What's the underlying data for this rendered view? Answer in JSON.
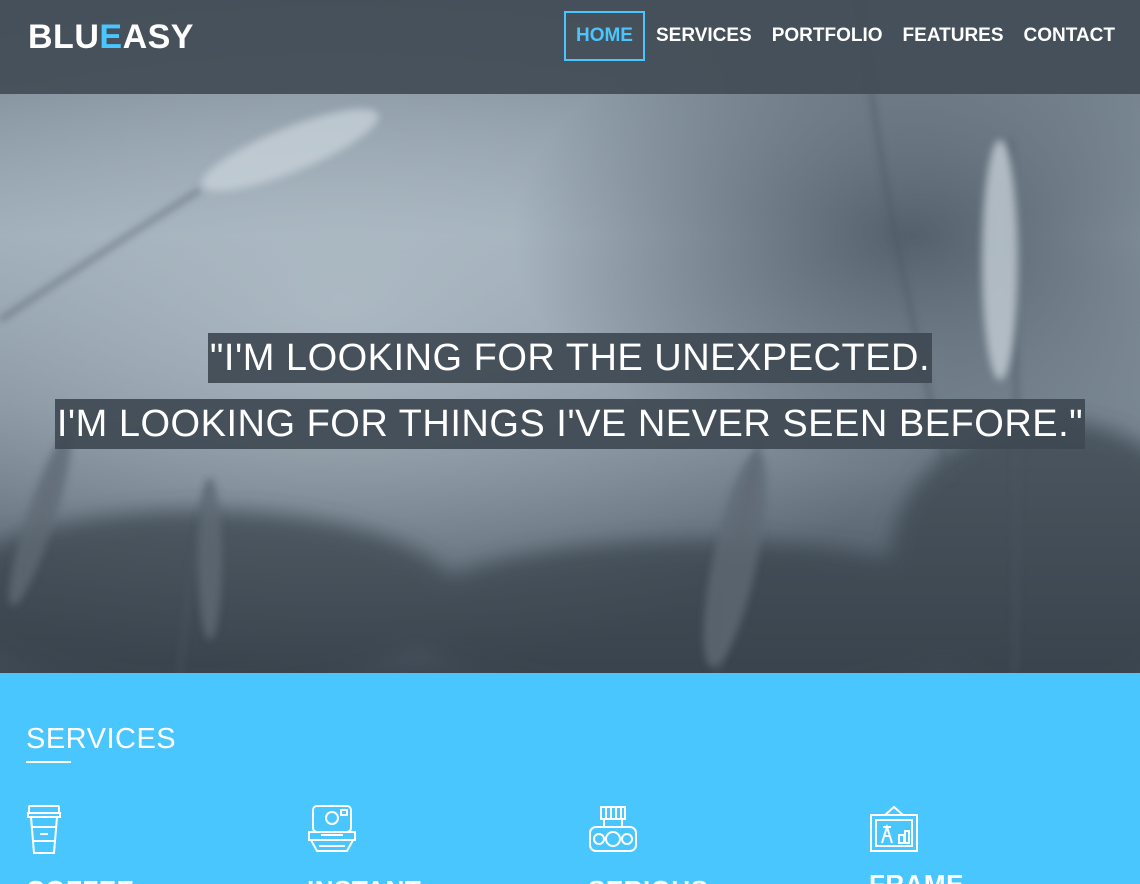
{
  "brand": {
    "part1": "BLU",
    "accent": "E",
    "part2": "ASY"
  },
  "nav": {
    "items": [
      {
        "label": "HOME",
        "active": true
      },
      {
        "label": "SERVICES",
        "active": false
      },
      {
        "label": "PORTFOLIO",
        "active": false
      },
      {
        "label": "FEATURES",
        "active": false
      },
      {
        "label": "CONTACT",
        "active": false
      }
    ]
  },
  "hero": {
    "quote_line1": "\"I'M LOOKING FOR THE UNEXPECTED.",
    "quote_line2": "I'M LOOKING FOR THINGS I'VE NEVER SEEN BEFORE.\""
  },
  "services": {
    "title": "SERVICES",
    "items": [
      {
        "icon": "coffee-cup-icon",
        "title": "COFFEE"
      },
      {
        "icon": "instant-camera-icon",
        "title": "INSTANT"
      },
      {
        "icon": "dslr-camera-icon",
        "title": "SERIOUS"
      },
      {
        "icon": "frame-icon",
        "title": "FRAME"
      }
    ]
  },
  "colors": {
    "accent": "#49c6fd",
    "navbar": "#424c56",
    "quote_bg": "#3f4952"
  }
}
